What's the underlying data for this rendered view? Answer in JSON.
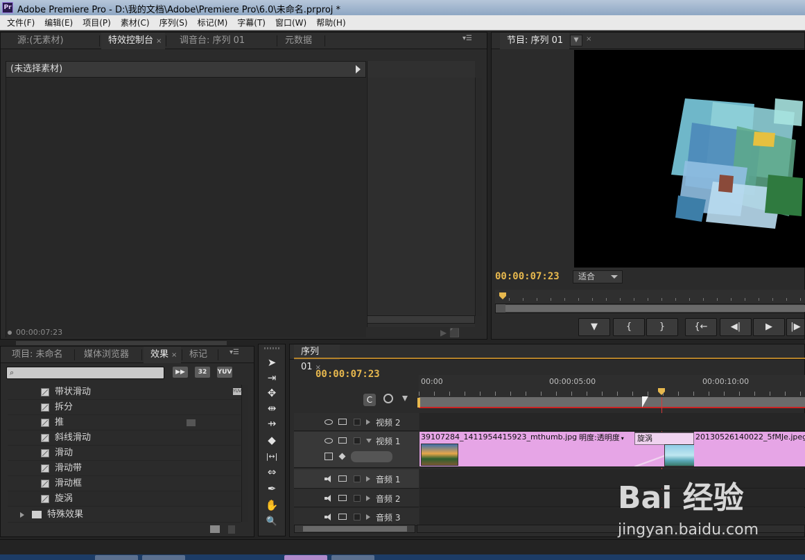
{
  "window": {
    "title": "Adobe Premiere Pro - D:\\我的文档\\Adobe\\Premiere Pro\\6.0\\未命名.prproj *",
    "app_icon": "Pr"
  },
  "menu": [
    "文件(F)",
    "编辑(E)",
    "项目(P)",
    "素材(C)",
    "序列(S)",
    "标记(M)",
    "字幕(T)",
    "窗口(W)",
    "帮助(H)"
  ],
  "top_left_panel": {
    "tabs": [
      {
        "label": "源:(无素材)",
        "active": false
      },
      {
        "label": "特效控制台",
        "active": true,
        "close": "×"
      },
      {
        "label": "调音台: 序列 01",
        "active": false
      },
      {
        "label": "元数据",
        "active": false
      }
    ],
    "header": "(未选择素材)",
    "timecode": "00:00:07:23"
  },
  "program_monitor": {
    "tab_label": "节目: 序列 01",
    "close": "×",
    "timecode": "00:00:07:23",
    "fit_label": "适合",
    "transport": [
      "▼",
      "{",
      "}",
      "{←",
      "◀|",
      "▶",
      "|▶"
    ]
  },
  "bottom_left_panel": {
    "tabs": [
      {
        "label": "项目: 未命名",
        "active": false
      },
      {
        "label": "媒体浏览器",
        "active": false
      },
      {
        "label": "效果",
        "active": true,
        "close": "×"
      },
      {
        "label": "标记",
        "active": false
      }
    ],
    "search_icon": "⌕",
    "buttons": [
      "▶▶",
      "32",
      "YUV"
    ],
    "effects": [
      {
        "label": "带状滑动",
        "badge": "YUV"
      },
      {
        "label": "拆分"
      },
      {
        "label": "推"
      },
      {
        "label": "斜线滑动"
      },
      {
        "label": "滑动"
      },
      {
        "label": "滑动带"
      },
      {
        "label": "滑动框"
      },
      {
        "label": "旋涡",
        "selected": true
      },
      {
        "label": "特殊效果",
        "folder": true
      }
    ]
  },
  "tools": [
    "➤",
    "⇥",
    "✥",
    "⇹",
    "⇸",
    "◆",
    "|↔|",
    "⇔",
    "✒",
    "✋",
    "🔍"
  ],
  "timeline": {
    "tab_label": "序列 01",
    "close": "×",
    "timecode": "00:00:07:23",
    "ruler_labels": [
      "00:00",
      "00:00:05:00",
      "00:00:10:00"
    ],
    "tracks": [
      {
        "name": "视频 2",
        "type": "video"
      },
      {
        "name": "视频 1",
        "type": "video"
      },
      {
        "name": "音频 1",
        "type": "audio"
      },
      {
        "name": "音频 2",
        "type": "audio"
      },
      {
        "name": "音频 3",
        "type": "audio"
      }
    ],
    "clips": {
      "clip_a": "39107284_1411954415923_mthumb.jpg",
      "opacity_label": "明度:透明度",
      "transition": "旋涡",
      "clip_b": "20130526140022_5fMJe.jpeg"
    }
  },
  "watermark": {
    "logo": "Bai 经验",
    "url": "jingyan.baidu.com"
  }
}
